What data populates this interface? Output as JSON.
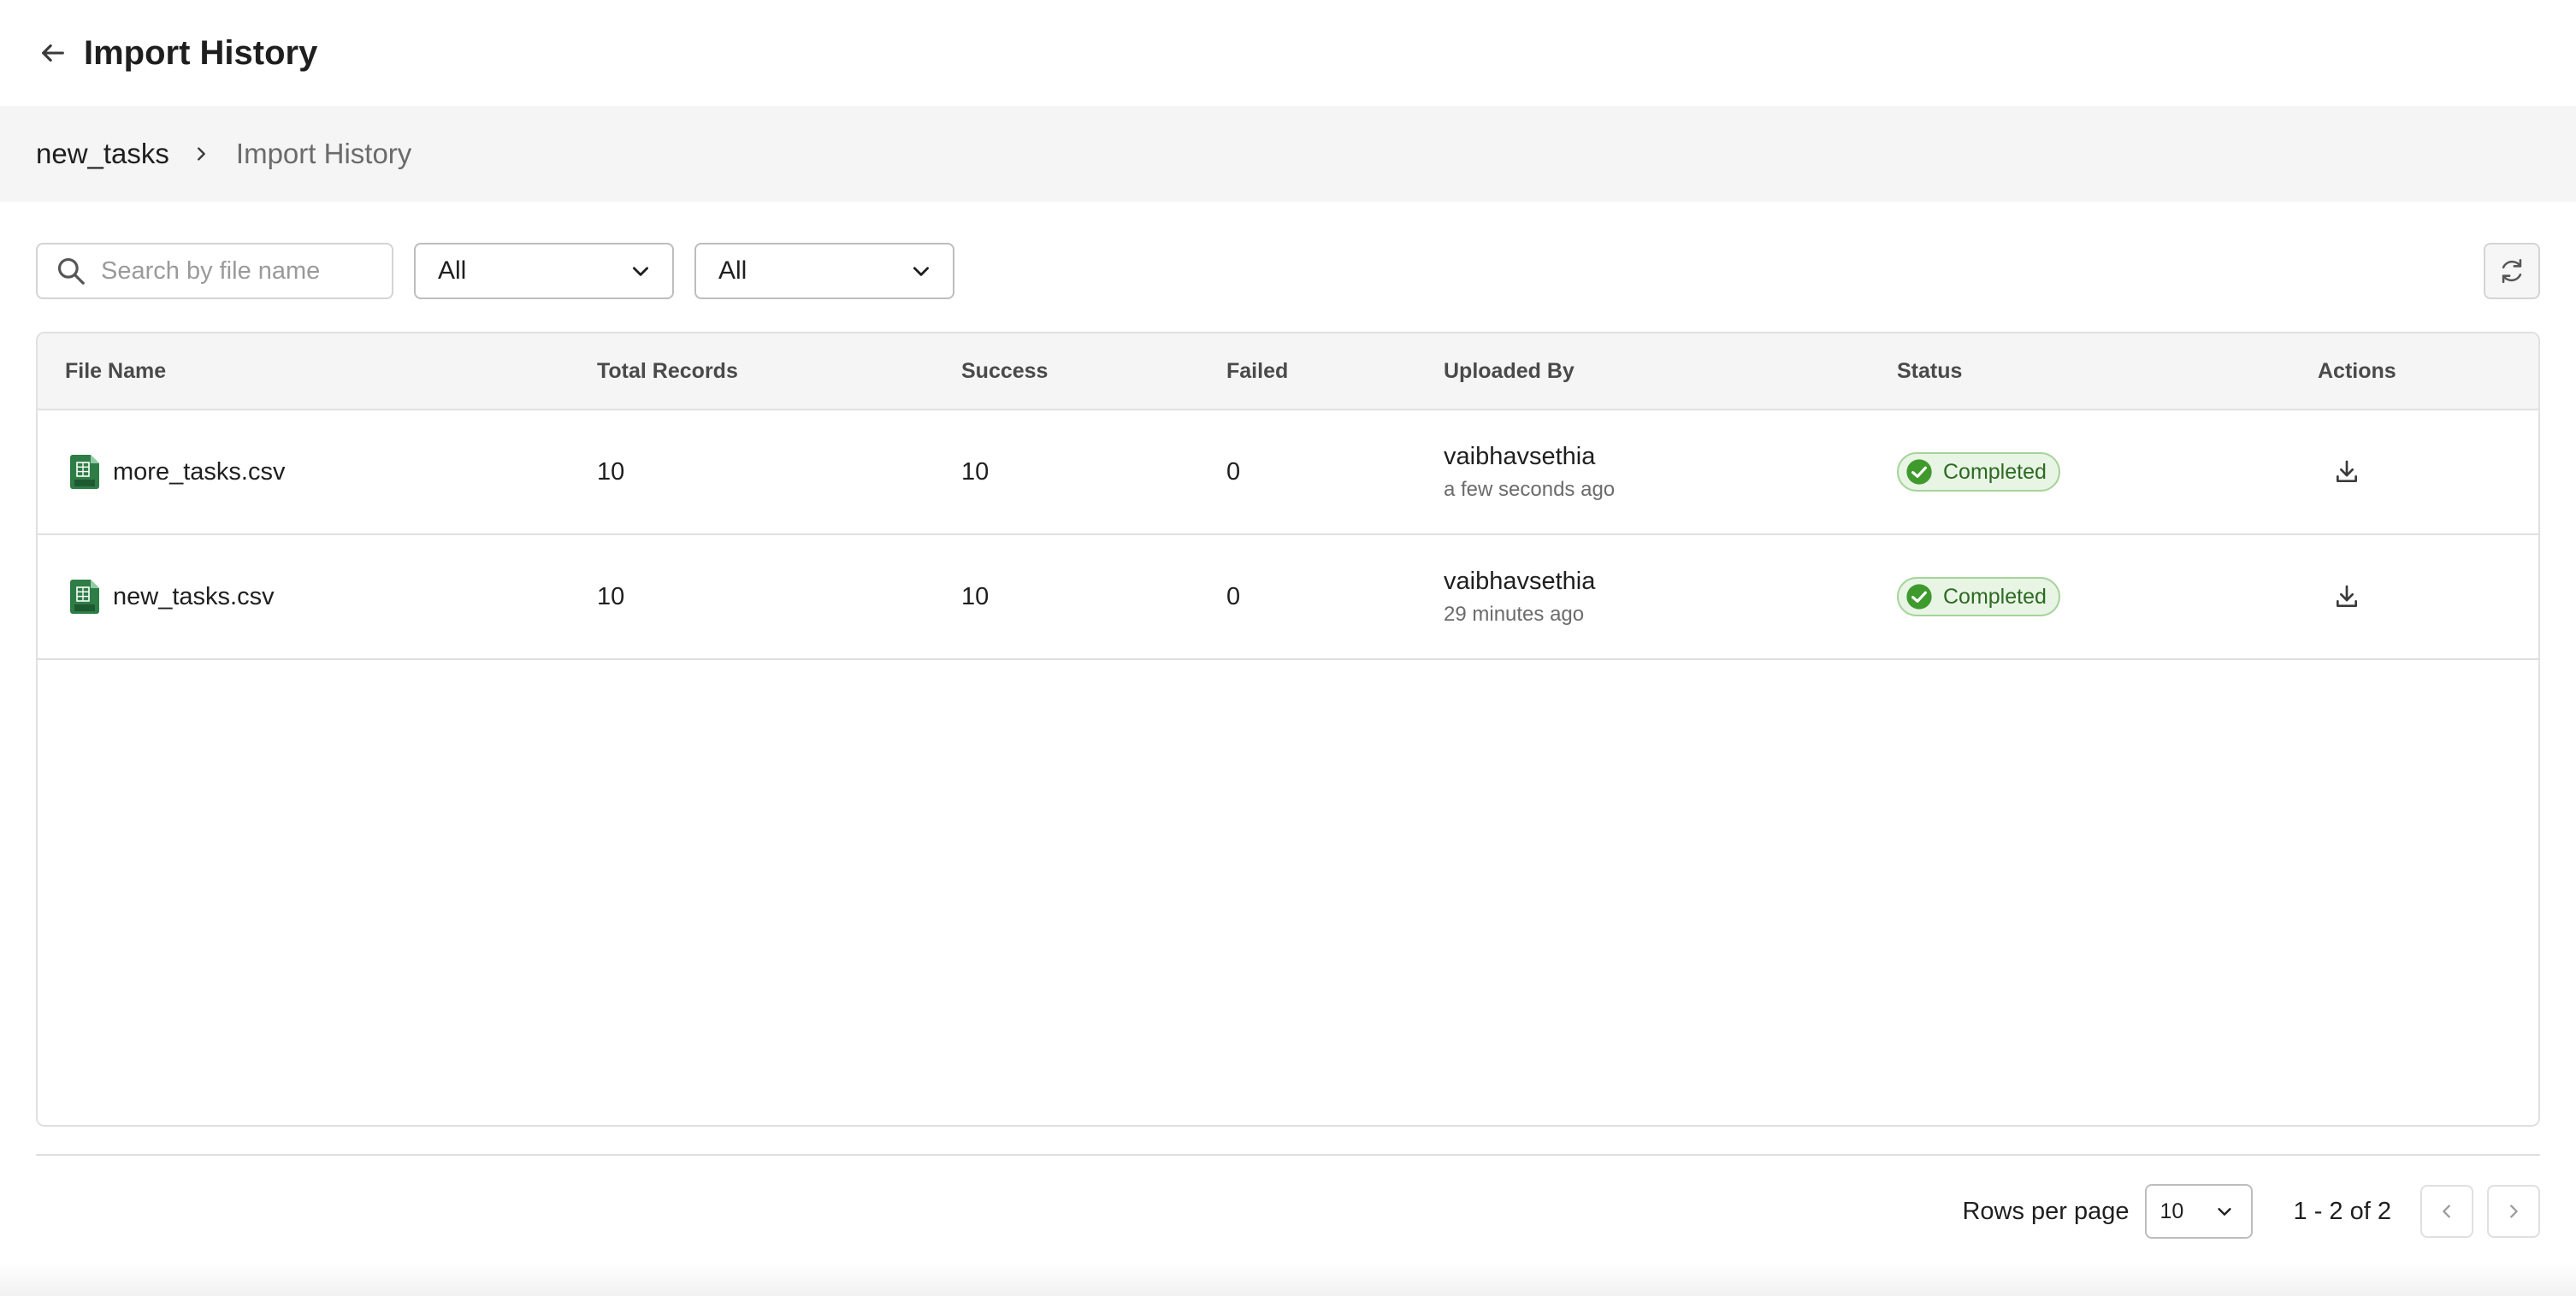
{
  "header": {
    "title": "Import History"
  },
  "breadcrumb": {
    "parent": "new_tasks",
    "current": "Import History"
  },
  "toolbar": {
    "search_placeholder": "Search by file name",
    "filter1_value": "All",
    "filter2_value": "All"
  },
  "table": {
    "columns": {
      "file_name": "File Name",
      "total_records": "Total Records",
      "success": "Success",
      "failed": "Failed",
      "uploaded_by": "Uploaded By",
      "status": "Status",
      "actions": "Actions"
    },
    "rows": [
      {
        "file_name": "more_tasks.csv",
        "total_records": "10",
        "success": "10",
        "failed": "0",
        "uploaded_by": "vaibhavsethia",
        "uploaded_time": "a few seconds ago",
        "status": "Completed"
      },
      {
        "file_name": "new_tasks.csv",
        "total_records": "10",
        "success": "10",
        "failed": "0",
        "uploaded_by": "vaibhavsethia",
        "uploaded_time": "29 minutes ago",
        "status": "Completed"
      }
    ]
  },
  "pagination": {
    "rows_per_page_label": "Rows per page",
    "rows_per_page_value": "10",
    "range": "1 - 2 of 2"
  },
  "colors": {
    "status_success": "#2d6a22",
    "status_success_bg": "#e8f5e5",
    "csv_icon": "#2e7d46"
  },
  "icons": {
    "back": "arrow-left-icon",
    "breadcrumb_separator": "chevron-right-icon",
    "search": "search-icon",
    "dropdown": "chevron-down-icon",
    "refresh": "refresh-icon",
    "file": "csv-file-icon",
    "status": "check-circle-icon",
    "download": "download-icon",
    "prev": "chevron-left-icon",
    "next": "chevron-right-icon"
  }
}
